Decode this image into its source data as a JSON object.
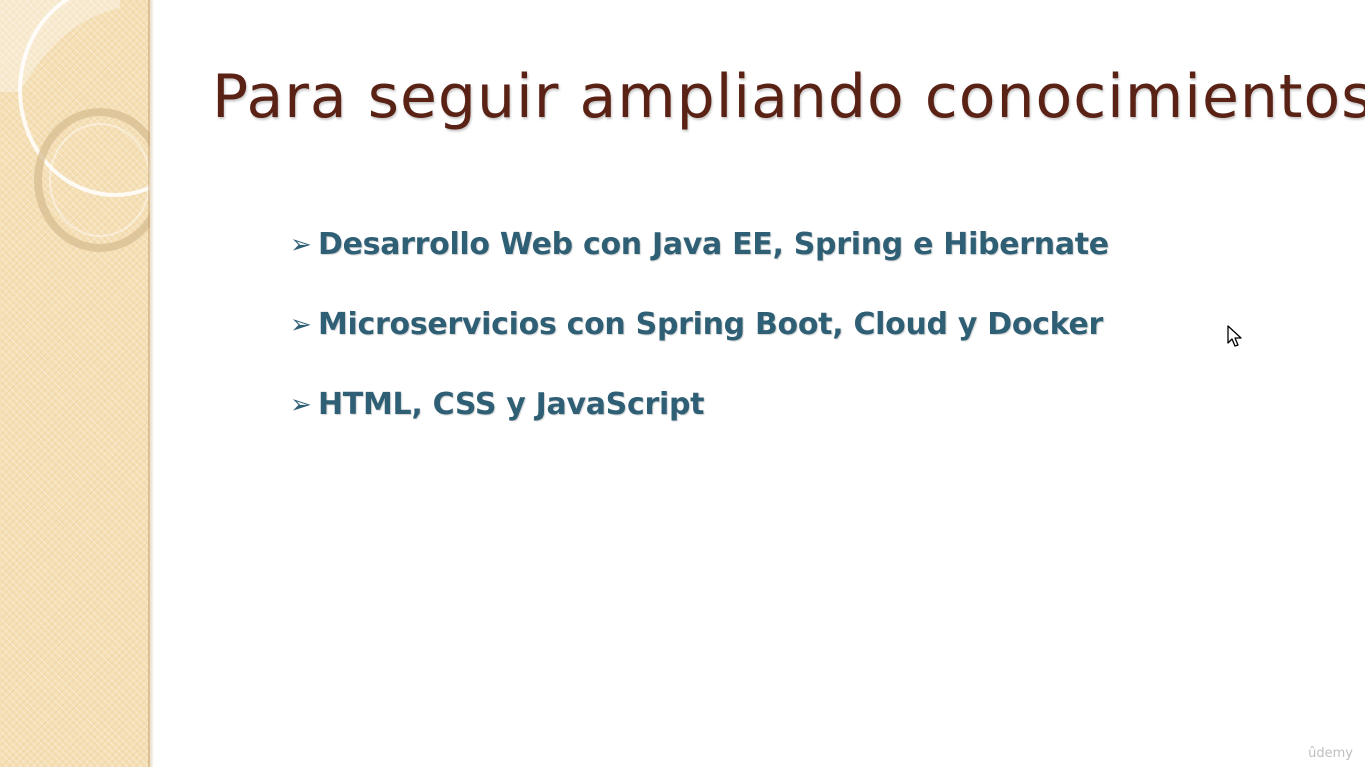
{
  "slide": {
    "title": "Para seguir ampliando conocimientos…",
    "bullet_glyph": "➢",
    "bullets": [
      "Desarrollo Web con Java EE, Spring e Hibernate",
      "Microservicios con Spring Boot, Cloud y Docker",
      "HTML, CSS y JavaScript"
    ]
  },
  "watermark": "ûdemy",
  "colors": {
    "title": "#5a2115",
    "bullet_text": "#2e5f75",
    "side_panel": "#f5dfb5"
  },
  "icons": {
    "cursor": "mouse-pointer-icon",
    "decoration": "decorative-rings"
  }
}
